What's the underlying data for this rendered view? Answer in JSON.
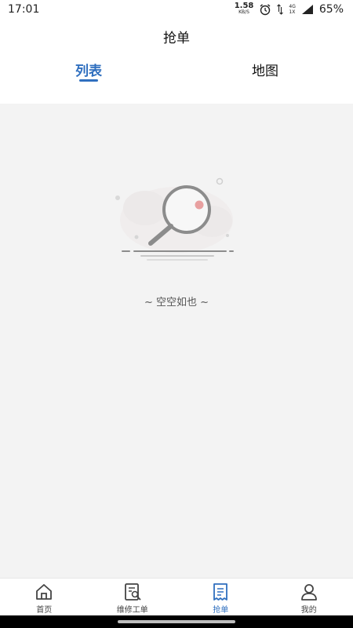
{
  "status_bar": {
    "time": "17:01",
    "net_speed_value": "1.58",
    "net_speed_unit": "KB/S",
    "network_type": "4G",
    "sim_slot": "1X",
    "battery": "65%"
  },
  "header": {
    "title": "抢单",
    "tabs": [
      {
        "label": "列表",
        "active": true
      },
      {
        "label": "地图",
        "active": false
      }
    ]
  },
  "empty_state": {
    "text": "~ 空空如也 ~",
    "icon": "magnifier-icon"
  },
  "bottom_nav": {
    "items": [
      {
        "label": "首页",
        "icon": "home-icon",
        "active": false
      },
      {
        "label": "维修工单",
        "icon": "repair-order-icon",
        "active": false
      },
      {
        "label": "抢单",
        "icon": "grab-order-icon",
        "active": true
      },
      {
        "label": "我的",
        "icon": "profile-icon",
        "active": false
      }
    ]
  },
  "colors": {
    "accent": "#2f6fbf",
    "background": "#f3f3f3",
    "surface": "#ffffff"
  }
}
